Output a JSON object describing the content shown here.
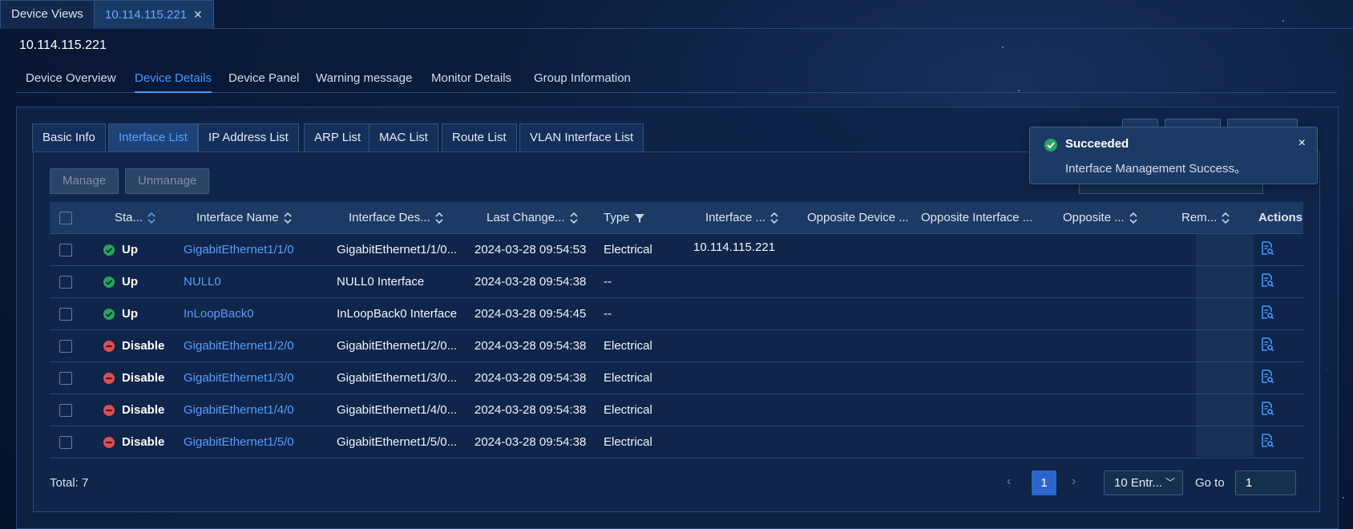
{
  "top_tabs": [
    {
      "label": "Device Views",
      "active": false
    },
    {
      "label": "10.114.115.221",
      "active": true
    }
  ],
  "device_ip": "10.114.115.221",
  "sub_tabs": [
    "Device Overview",
    "Device Details",
    "Device Panel",
    "Warning message",
    "Monitor Details",
    "Group Information"
  ],
  "sub_tab_active": "Device Details",
  "inner_tabs": [
    "Basic Info",
    "Interface List",
    "IP Address List",
    "ARP List",
    "MAC List",
    "Route List",
    "VLAN Interface List"
  ],
  "inner_tab_active": "Interface List",
  "buttons": {
    "manage": "Manage",
    "unmanage": "Unmanage"
  },
  "table": {
    "headers": {
      "status": "Sta...",
      "name": "Interface Name",
      "desc": "Interface Des...",
      "last_change": "Last Change...",
      "type": "Type",
      "iface_ip": "Interface ...",
      "opp_device": "Opposite Device ...",
      "opp_iface": "Opposite Interface ...",
      "opp": "Opposite ...",
      "remark": "Rem...",
      "actions": "Actions"
    },
    "rows": [
      {
        "status": "Up",
        "state": "up",
        "name": "GigabitEthernet1/1/0",
        "desc": "GigabitEthernet1/1/0...",
        "last_change": "2024-03-28 09:54:53",
        "type": "Electrical",
        "iface_ip": "10.114.115.221"
      },
      {
        "status": "Up",
        "state": "up",
        "name": "NULL0",
        "desc": "NULL0 Interface",
        "last_change": "2024-03-28 09:54:38",
        "type": "--",
        "iface_ip": ""
      },
      {
        "status": "Up",
        "state": "up",
        "name": "InLoopBack0",
        "desc": "InLoopBack0 Interface",
        "last_change": "2024-03-28 09:54:45",
        "type": "--",
        "iface_ip": ""
      },
      {
        "status": "Disable",
        "state": "disable",
        "name": "GigabitEthernet1/2/0",
        "desc": "GigabitEthernet1/2/0...",
        "last_change": "2024-03-28 09:54:38",
        "type": "Electrical",
        "iface_ip": ""
      },
      {
        "status": "Disable",
        "state": "disable",
        "name": "GigabitEthernet1/3/0",
        "desc": "GigabitEthernet1/3/0...",
        "last_change": "2024-03-28 09:54:38",
        "type": "Electrical",
        "iface_ip": ""
      },
      {
        "status": "Disable",
        "state": "disable",
        "name": "GigabitEthernet1/4/0",
        "desc": "GigabitEthernet1/4/0...",
        "last_change": "2024-03-28 09:54:38",
        "type": "Electrical",
        "iface_ip": ""
      },
      {
        "status": "Disable",
        "state": "disable",
        "name": "GigabitEthernet1/5/0",
        "desc": "GigabitEthernet1/5/0...",
        "last_change": "2024-03-28 09:54:38",
        "type": "Electrical",
        "iface_ip": ""
      }
    ]
  },
  "footer": {
    "total": "Total: 7",
    "page": "1",
    "page_size": "10 Entr...",
    "goto_label": "Go to",
    "goto_value": "1"
  },
  "toast": {
    "title": "Succeeded",
    "message": "Interface Management Success。",
    "close": "×"
  },
  "colors": {
    "accent": "#4c97ff",
    "link": "#5a9cff",
    "up": "#27a55d",
    "disable": "#e34c4c",
    "page_active": "#2a66cc"
  }
}
